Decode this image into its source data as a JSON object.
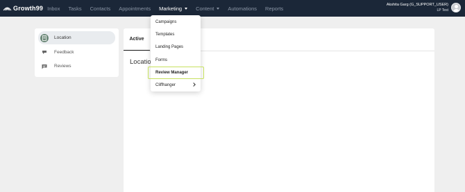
{
  "brand": {
    "name": "Growth99"
  },
  "nav": {
    "items": [
      {
        "label": "Inbox",
        "active": false,
        "has_caret": false
      },
      {
        "label": "Tasks",
        "active": false,
        "has_caret": false
      },
      {
        "label": "Contacts",
        "active": false,
        "has_caret": false
      },
      {
        "label": "Appointments",
        "active": false,
        "has_caret": false
      },
      {
        "label": "Marketing",
        "active": true,
        "has_caret": true
      },
      {
        "label": "Content",
        "active": false,
        "has_caret": true
      },
      {
        "label": "Automations",
        "active": false,
        "has_caret": false
      },
      {
        "label": "Reports",
        "active": false,
        "has_caret": false
      }
    ]
  },
  "user": {
    "name": "Akshita Garg (G_SUPPORT_USER)",
    "sub": "LP Test"
  },
  "sidebar": {
    "items": [
      {
        "label": "Location",
        "icon": "building-icon",
        "active": true
      },
      {
        "label": "Feedback",
        "icon": "feedback-icon",
        "active": false
      },
      {
        "label": "Reviews",
        "icon": "chat-icon",
        "active": false
      }
    ]
  },
  "main": {
    "tab_label": "Active",
    "section_title": "Location"
  },
  "marketing_menu": {
    "items": [
      {
        "label": "Campaigns"
      },
      {
        "label": "Templates"
      },
      {
        "label": "Landing Pages"
      },
      {
        "label": "Forms"
      },
      {
        "label": "Review Manager",
        "highlighted": true
      },
      {
        "label": "Cliffhanger",
        "has_submenu": true
      }
    ]
  },
  "colors": {
    "topbar": "#1b2738",
    "nav_inactive": "#8b96a6",
    "highlight_border": "#c6e05e",
    "sidebar_active_bg": "#e9ecef",
    "sidebar_icon_active": "#6e8a7a"
  }
}
